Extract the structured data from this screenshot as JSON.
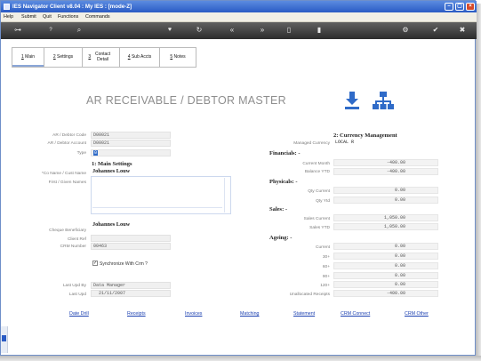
{
  "window": {
    "title": "IES Navigator Client v8.04 : My IES :      [mode-Z]"
  },
  "menu": [
    "Help",
    "Submit",
    "Quit",
    "Functions",
    "Commands"
  ],
  "tabs": [
    {
      "num": "1",
      "label": "Main"
    },
    {
      "num": "2",
      "label": "Settings"
    },
    {
      "num": "3",
      "label": "Contact Detail"
    },
    {
      "num": "4",
      "label": "Sub Accts"
    },
    {
      "num": "5",
      "label": "Notes"
    }
  ],
  "header": {
    "title": "AR RECEIVABLE / DEBTOR MASTER"
  },
  "left": {
    "debtor_code": {
      "label": "AR / Debtor Code",
      "value": "D00021"
    },
    "debtor_account": {
      "label": "AR / Debtor Account",
      "value": "D00021"
    },
    "type": {
      "label": "Type",
      "value": "0"
    },
    "main_settings": "1: Main Settings",
    "co_name": {
      "label": "*Co Name / Cust Name",
      "value": "Johannes Louw"
    },
    "first_names": {
      "label": "First / Given Names",
      "value": ""
    },
    "cheque_beneficiary": {
      "label": "Cheque Beneficiary",
      "value": "Johannes Louw"
    },
    "client_ref": {
      "label": "Client Ref",
      "value": ""
    },
    "crm_number": {
      "label": "CRM Number",
      "value": "00463"
    },
    "sync_crm": {
      "label": "Synchronize With Crm ?",
      "checked": true
    },
    "last_upd_by": {
      "label": "Last Upd By",
      "value": "Data Manager"
    },
    "last_upd": {
      "label": "Last Upd",
      "value": "21/11/2007"
    }
  },
  "right": {
    "currency_title": "2: Currency Management",
    "managed_currency": {
      "label": "Managed Currency",
      "value": "LOCAL R"
    },
    "financials": "Financials: -",
    "current_month": {
      "label": "Current Month",
      "value": "-400.00"
    },
    "balance_ytd": {
      "label": "Balance YTD",
      "value": "-400.00"
    },
    "physicals": "Physicals: -",
    "qty_current": {
      "label": "Qty Current",
      "value": "0.00"
    },
    "qty_ytd": {
      "label": "Qty Ytd",
      "value": "0.00"
    },
    "sales": "Sales: -",
    "sales_current": {
      "label": "Sales Current",
      "value": "1,050.00"
    },
    "sales_ytd": {
      "label": "Sales YTD",
      "value": "1,050.00"
    },
    "ageing": "Ageing: -",
    "ageing_current": {
      "label": "Current",
      "value": "0.00"
    },
    "age30": {
      "label": "30+",
      "value": "0.00"
    },
    "age60": {
      "label": "60+",
      "value": "0.00"
    },
    "age90": {
      "label": "90+",
      "value": "0.00"
    },
    "age120": {
      "label": "120+",
      "value": "0.00"
    },
    "unallocated": {
      "label": "Unallocated Receipts",
      "value": "-400.00"
    }
  },
  "links": [
    "Date Drill",
    "Receipts",
    "Invoices",
    "Matching",
    "Statement",
    "CRM Connect",
    "CRM Other"
  ],
  "colors": {
    "titlebar": "#2a5bc4",
    "link": "#1a3fb0",
    "accent": "#2f6bc8"
  }
}
